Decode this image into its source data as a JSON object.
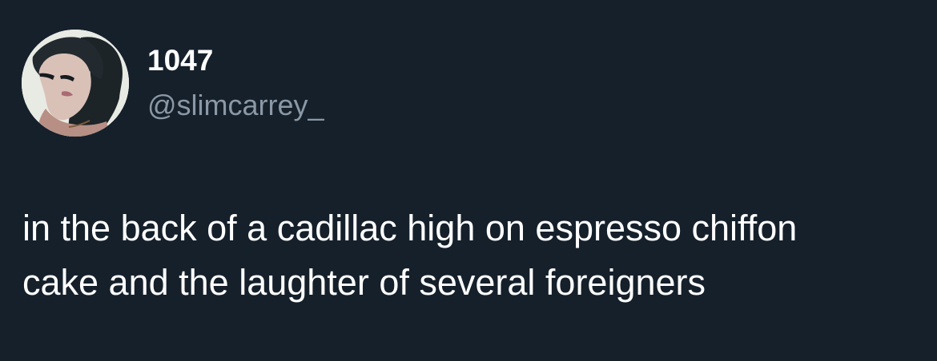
{
  "tweet": {
    "author": {
      "display_name": "1047",
      "handle": "@slimcarrey_",
      "avatar_icon": "profile-photo"
    },
    "text_lines": [
      "in the back of a cadillac high on espresso chiffon",
      "cake and the laughter of several foreigners"
    ]
  },
  "colors": {
    "background": "#15202b",
    "text_primary": "#ffffff",
    "text_secondary": "#8b98a5"
  }
}
